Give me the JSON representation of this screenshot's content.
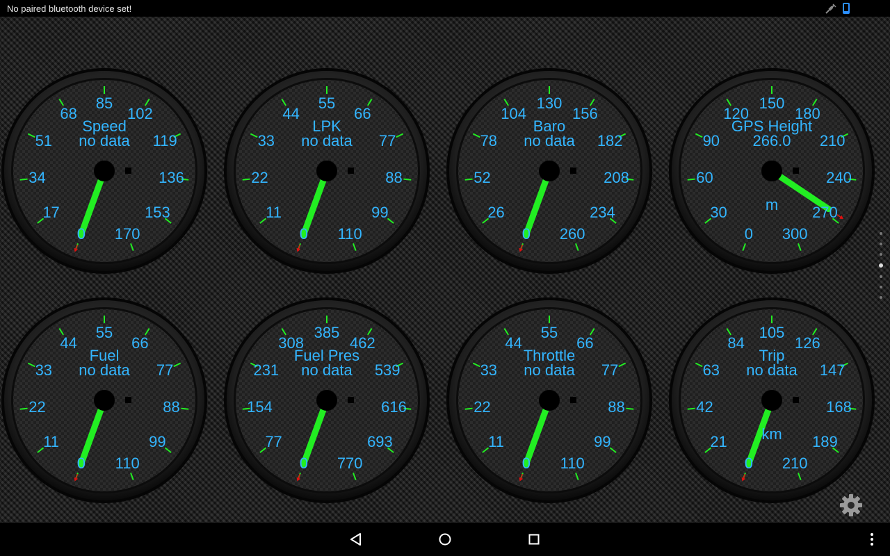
{
  "status_bar": {
    "message": "No paired bluetooth device set!",
    "icons": [
      "gps-satellite-icon",
      "phone-icon"
    ]
  },
  "gauges": [
    {
      "title": "Speed",
      "value": "no data",
      "unit": "",
      "ticks": [
        "0",
        "17",
        "34",
        "51",
        "68",
        "85",
        "102",
        "119",
        "136",
        "153",
        "170"
      ],
      "needle_fraction": 0.0
    },
    {
      "title": "LPK",
      "value": "no data",
      "unit": "",
      "ticks": [
        "0",
        "11",
        "22",
        "33",
        "44",
        "55",
        "66",
        "77",
        "88",
        "99",
        "110"
      ],
      "needle_fraction": 0.0
    },
    {
      "title": "Baro",
      "value": "no data",
      "unit": "",
      "ticks": [
        "0",
        "26",
        "52",
        "78",
        "104",
        "130",
        "156",
        "182",
        "208",
        "234",
        "260"
      ],
      "needle_fraction": 0.0
    },
    {
      "title": "GPS Height",
      "value": "266.0",
      "unit": "m",
      "ticks": [
        "0",
        "30",
        "60",
        "90",
        "120",
        "150",
        "180",
        "210",
        "240",
        "270",
        "300"
      ],
      "needle_fraction": 0.887
    },
    {
      "title": "Fuel",
      "value": "no data",
      "unit": "",
      "ticks": [
        "0",
        "11",
        "22",
        "33",
        "44",
        "55",
        "66",
        "77",
        "88",
        "99",
        "110"
      ],
      "needle_fraction": 0.0
    },
    {
      "title": "Fuel Pres",
      "value": "no data",
      "unit": "",
      "ticks": [
        "0",
        "77",
        "154",
        "231",
        "308",
        "385",
        "462",
        "539",
        "616",
        "693",
        "770"
      ],
      "needle_fraction": 0.0
    },
    {
      "title": "Throttle",
      "value": "no data",
      "unit": "",
      "ticks": [
        "0",
        "11",
        "22",
        "33",
        "44",
        "55",
        "66",
        "77",
        "88",
        "99",
        "110"
      ],
      "needle_fraction": 0.0
    },
    {
      "title": "Trip",
      "value": "no data",
      "unit": "km",
      "ticks": [
        "0",
        "21",
        "42",
        "63",
        "84",
        "105",
        "126",
        "147",
        "168",
        "189",
        "210"
      ],
      "needle_fraction": 0.0
    }
  ],
  "page_indicator": {
    "pages": 7,
    "active": 3
  },
  "colors": {
    "label": "#33b5ff",
    "needle": "#22ee22",
    "marker": "#e01010",
    "tick_mark": "#22ee22"
  },
  "settings_icon": "gear-icon",
  "nav_bar": {
    "icons": [
      "back-icon",
      "home-icon",
      "recents-icon",
      "overflow-menu-icon"
    ]
  }
}
